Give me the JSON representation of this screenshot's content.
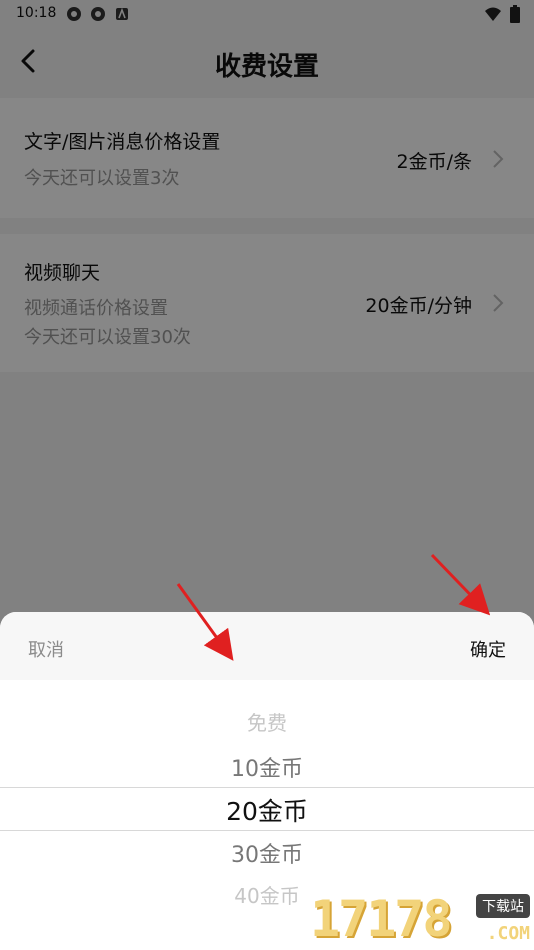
{
  "status": {
    "time": "10:18",
    "left_icons": [
      "shutter-icon",
      "shutter-icon",
      "a-notification-icon"
    ],
    "right_icons": [
      "wifi-icon",
      "battery-icon"
    ]
  },
  "header": {
    "title": "收费设置",
    "back_icon": "chevron-left-icon"
  },
  "settings": [
    {
      "title": "文字/图片消息价格设置",
      "lines": [
        "今天还可以设置3次"
      ],
      "value": "2金币/条"
    },
    {
      "title": "视频聊天",
      "lines": [
        "视频通话价格设置",
        "今天还可以设置30次"
      ],
      "value": "20金币/分钟"
    }
  ],
  "sheet": {
    "cancel_label": "取消",
    "confirm_label": "确定",
    "options": [
      "免费",
      "10金币",
      "20金币",
      "30金币",
      "40金币"
    ],
    "selected": "20金币"
  },
  "watermark": {
    "digits": "17178",
    "badge": "下载站",
    "suffix": ".COM"
  },
  "colors": {
    "overlay": "#7e7e7e",
    "annotation_arrow": "#e02020",
    "watermark": "#f2d37a"
  }
}
